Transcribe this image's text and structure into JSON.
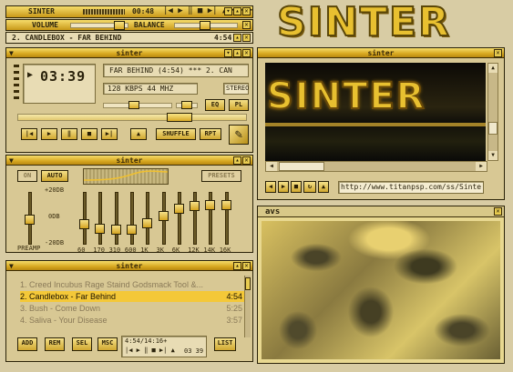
{
  "app": {
    "logo": "SINTER"
  },
  "mini": {
    "title": "SINTER",
    "time": "00:48",
    "volume_label": "VOLUME",
    "balance_label": "BALANCE",
    "track": "2. CANDLEBOX - FAR BEHIND",
    "track_time": "4:54"
  },
  "main": {
    "title": "sinter",
    "time": "03:39",
    "song": "FAR BEHIND (4:54)  ***  2. CAN",
    "bitrate": "128 KBPS 44 MHZ",
    "stereo": "STEREO",
    "eq_btn": "EQ",
    "pl_btn": "PL",
    "shuffle": "SHUFFLE",
    "repeat": "RPT"
  },
  "eq": {
    "title": "sinter",
    "on": "ON",
    "auto": "AUTO",
    "presets": "PRESETS",
    "db_top": "+20DB",
    "db_mid": "0DB",
    "db_bot": "-20DB",
    "preamp": "PREAMP",
    "bands": [
      "60",
      "170",
      "310",
      "600",
      "1K",
      "3K",
      "6K",
      "12K",
      "14K",
      "16K"
    ],
    "band_levels": [
      0.38,
      0.28,
      0.26,
      0.26,
      0.4,
      0.58,
      0.74,
      0.8,
      0.82,
      0.82
    ],
    "preamp_level": 0.5
  },
  "playlist": {
    "title": "sinter",
    "items": [
      {
        "label": "1. Creed Incubus Rage Staind Godsmack Tool &...",
        "dur": ""
      },
      {
        "label": "2. Candlebox - Far Behind",
        "dur": "4:54"
      },
      {
        "label": "3. Bush - Come Down",
        "dur": "5:25"
      },
      {
        "label": "4. Saliva - Your Disease",
        "dur": "3:57"
      }
    ],
    "add": "ADD",
    "rem": "REM",
    "sel": "SEL",
    "msc": "MSC",
    "list": "LIST",
    "info": "4:54/14:16+",
    "clock": "03 39"
  },
  "browser": {
    "title": "sinter",
    "banner": "SINTER",
    "url": "http://www.titanpsp.com/ss/Sinter_"
  },
  "avs": {
    "title": "avs"
  },
  "colors": {
    "accent": "#e8c030",
    "frame": "#2a2208",
    "lcd": "#e8dcb4"
  }
}
